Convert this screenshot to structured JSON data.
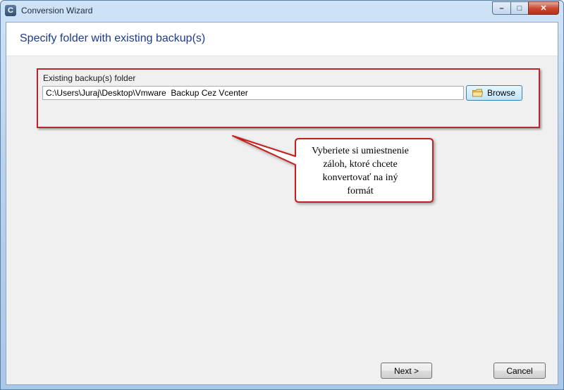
{
  "window": {
    "title": "Conversion Wizard",
    "app_icon_glyph": "C",
    "caption_buttons": {
      "minimize": "–",
      "maximize": "□",
      "close": "✕"
    }
  },
  "header": {
    "title": "Specify folder with existing backup(s)"
  },
  "folder": {
    "label": "Existing backup(s) folder",
    "path_value": "C:\\Users\\Juraj\\Desktop\\Vmware  Backup Cez Vcenter",
    "browse_label": "Browse"
  },
  "callout": {
    "lines": [
      "Vyberiete si umiestnenie",
      "záloh, ktoré chcete",
      "konvertovať na iný",
      "formát"
    ]
  },
  "footer": {
    "next_label": "Next >",
    "cancel_label": "Cancel"
  },
  "colors": {
    "header_title": "#1e3a8a",
    "highlight_border": "#b8262e",
    "callout_border": "#c41e1e"
  },
  "icons": {
    "app": "app-logo-icon",
    "browse": "folder-icon"
  }
}
